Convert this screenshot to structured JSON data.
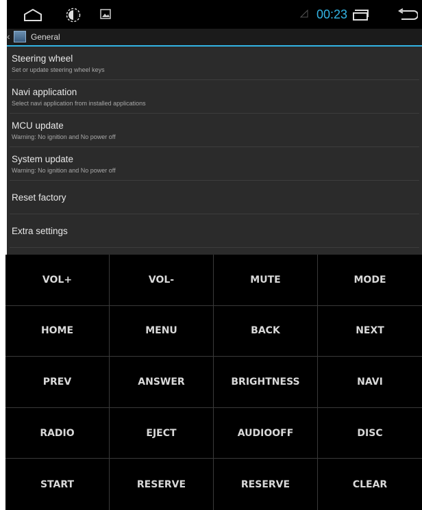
{
  "status_bar": {
    "clock": "00:23",
    "icons": [
      "home-icon",
      "brightness-icon",
      "gallery-icon",
      "signal-icon",
      "recent-apps-icon",
      "back-icon"
    ]
  },
  "action_bar": {
    "title": "General"
  },
  "menu": [
    {
      "title": "Steering wheel",
      "subtitle": "Set or update steering wheel keys"
    },
    {
      "title": "Navi application",
      "subtitle": "Select navi application from installed applications"
    },
    {
      "title": "MCU update",
      "subtitle": "Warning: No ignition and No power off"
    },
    {
      "title": "System update",
      "subtitle": "Warning: No ignition and No power off"
    },
    {
      "title": "Reset factory",
      "subtitle": ""
    },
    {
      "title": "Extra settings",
      "subtitle": ""
    }
  ],
  "keys": [
    "VOL+",
    "VOL-",
    "MUTE",
    "MODE",
    "HOME",
    "MENU",
    "BACK",
    "NEXT",
    "PREV",
    "ANSWER",
    "BRIGHTNESS",
    "NAVI",
    "RADIO",
    "EJECT",
    "AUDIOOFF",
    "DISC",
    "START",
    "RESERVE",
    "RESERVE",
    "CLEAR"
  ],
  "colors": {
    "accent": "#33b5e5",
    "background": "#2b2b2b",
    "keypad": "#000000"
  }
}
